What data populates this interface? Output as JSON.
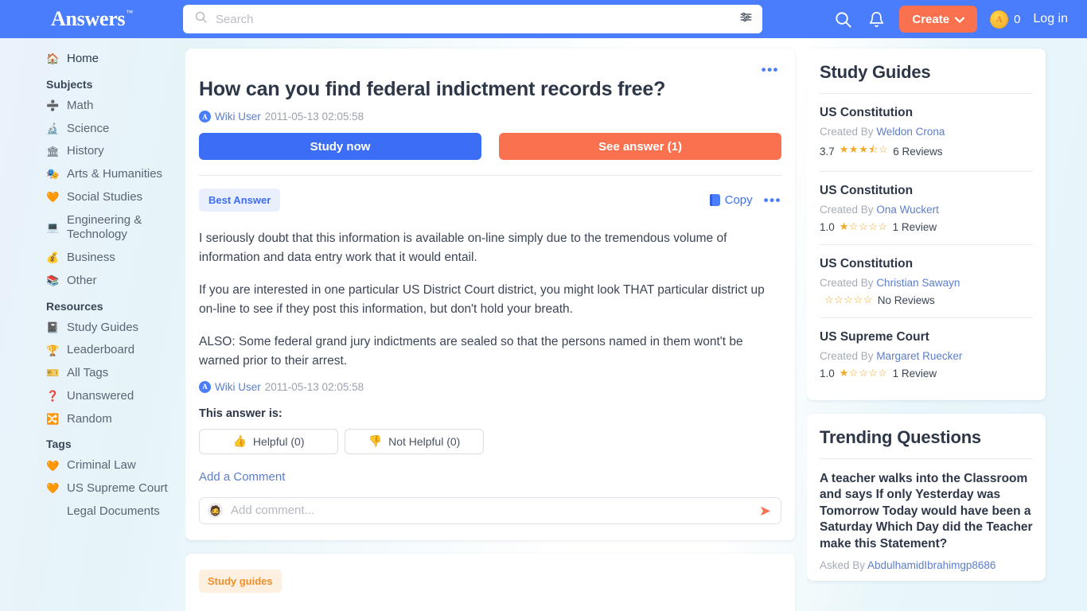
{
  "header": {
    "brand": "Answers",
    "brand_tm": "™",
    "search_placeholder": "Search",
    "search_value": "",
    "search_icon": "search-icon",
    "filter_icon": "filter-sliders-icon",
    "nav_search_icon": "search-icon",
    "bell_icon": "notifications-bell-icon",
    "create_label": "Create",
    "create_chevron": "⌄",
    "coin_glyph": "A",
    "coin_count": "0",
    "login_label": "Log in",
    "accent_blue": "#4a7dfb",
    "accent_orange": "#f9714f"
  },
  "sidebar": {
    "home": {
      "label": "Home",
      "icon": "🏠"
    },
    "subjects_heading": "Subjects",
    "subjects": [
      {
        "label": "Math",
        "icon": "➗"
      },
      {
        "label": "Science",
        "icon": "🔬"
      },
      {
        "label": "History",
        "icon": "🏛"
      },
      {
        "label": "Arts & Humanities",
        "icon": "🎭"
      },
      {
        "label": "Social Studies",
        "icon": "🧡"
      },
      {
        "label": "Engineering & Technology",
        "icon": "💻"
      },
      {
        "label": "Business",
        "icon": "💰"
      },
      {
        "label": "Other",
        "icon": "📚"
      }
    ],
    "resources_heading": "Resources",
    "resources": [
      {
        "label": "Study Guides",
        "icon": "📓"
      },
      {
        "label": "Leaderboard",
        "icon": "🏆"
      },
      {
        "label": "All Tags",
        "icon": "🎫"
      },
      {
        "label": "Unanswered",
        "icon": "❓"
      },
      {
        "label": "Random",
        "icon": "🔀"
      }
    ],
    "tags_heading": "Tags",
    "tags": [
      {
        "label": "Criminal Law",
        "icon": "🧡"
      },
      {
        "label": "US Supreme Court",
        "icon": "🧡"
      },
      {
        "label": "Legal Documents",
        "icon": ""
      }
    ]
  },
  "question": {
    "title": "How can you find federal indictment records free?",
    "author": "Wiki User",
    "date": "2011-05-13 02:05:58",
    "study_now_label": "Study now",
    "see_answer_label": "See answer (1)",
    "menu_dots": "•••"
  },
  "answer": {
    "badge": "Best Answer",
    "copy_label": "Copy",
    "menu_dots": "•••",
    "paragraphs": [
      "I seriously doubt that this information is available on-line simply due to the tremendous volume of information and data entry work that it would entail.",
      "If you are interested in one particular US District Court district, you might look THAT particular district up on-line to see if they post this information, but don't hold your breath.",
      "ALSO: Some federal grand jury indictments are sealed so that the persons named in them wont't be warned prior to their arrest."
    ],
    "author": "Wiki User",
    "date": "2011-05-13 02:05:58",
    "rating_prompt": "This answer is:",
    "helpful_label": "Helpful (0)",
    "helpful_icon": "👍",
    "not_helpful_label": "Not Helpful (0)",
    "not_helpful_icon": "👎",
    "add_comment_link": "Add a Comment",
    "comment_placeholder": "Add comment...",
    "comment_value": "",
    "send_icon": "➤"
  },
  "bottom_card": {
    "tag": "Study guides"
  },
  "study_guides": {
    "title": "Study Guides",
    "items": [
      {
        "name": "US Constitution",
        "created_by_label": "Created By",
        "creator": "Weldon Crona",
        "score": "3.7",
        "stars": "★★★⯪☆",
        "reviews": "6 Reviews"
      },
      {
        "name": "US Constitution",
        "created_by_label": "Created By",
        "creator": "Ona Wuckert",
        "score": "1.0",
        "stars": "★☆☆☆☆",
        "reviews": "1 Review"
      },
      {
        "name": "US Constitution",
        "created_by_label": "Created By",
        "creator": "Christian Sawayn",
        "score": "",
        "stars": "☆☆☆☆☆",
        "reviews": "No Reviews"
      },
      {
        "name": "US Supreme Court",
        "created_by_label": "Created By",
        "creator": "Margaret Ruecker",
        "score": "1.0",
        "stars": "★☆☆☆☆",
        "reviews": "1 Review"
      }
    ]
  },
  "trending": {
    "title": "Trending Questions",
    "items": [
      {
        "question": "A teacher walks into the Classroom and says If only Yesterday was Tomorrow Today would have been a Saturday Which Day did the Teacher make this Statement?",
        "asked_by_label": "Asked By",
        "asker": "AbdulhamidIbrahimgp8686"
      }
    ]
  }
}
